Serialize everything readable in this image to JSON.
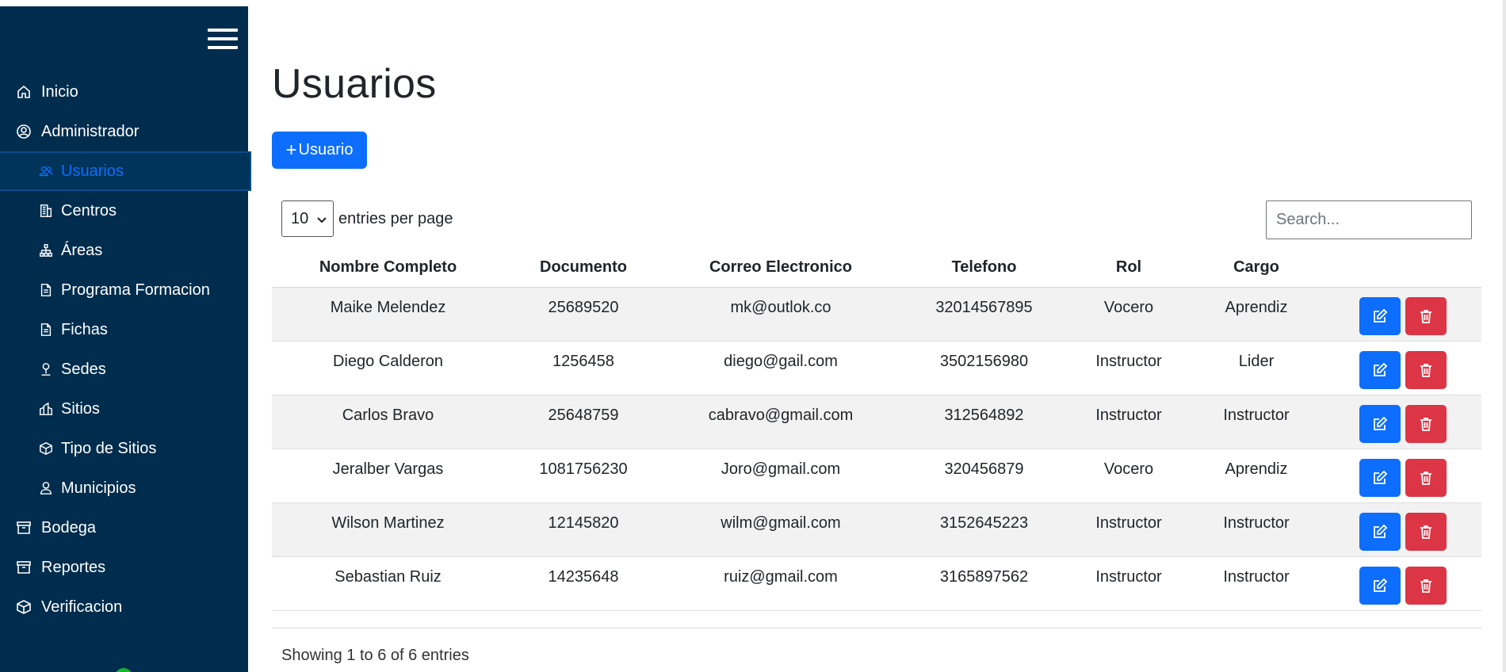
{
  "sidebar": {
    "items": [
      {
        "label": "Inicio",
        "icon": "home-icon",
        "level": 1
      },
      {
        "label": "Administrador",
        "icon": "user-circle-icon",
        "level": 1
      },
      {
        "label": "Usuarios",
        "icon": "users-icon",
        "level": 2,
        "active": true
      },
      {
        "label": "Centros",
        "icon": "building-icon",
        "level": 2
      },
      {
        "label": "Áreas",
        "icon": "hierarchy-icon",
        "level": 2
      },
      {
        "label": "Programa Formacion",
        "icon": "document-icon",
        "level": 2
      },
      {
        "label": "Fichas",
        "icon": "document-icon",
        "level": 2
      },
      {
        "label": "Sedes",
        "icon": "map-pin-icon",
        "level": 2
      },
      {
        "label": "Sitios",
        "icon": "buildings-icon",
        "level": 2
      },
      {
        "label": "Tipo de Sitios",
        "icon": "box-icon",
        "level": 2
      },
      {
        "label": "Municipios",
        "icon": "person-icon",
        "level": 2
      },
      {
        "label": "Bodega",
        "icon": "archive-icon",
        "level": 1
      },
      {
        "label": "Reportes",
        "icon": "archive-icon",
        "level": 1
      },
      {
        "label": "Verificacion",
        "icon": "box-icon",
        "level": 1
      }
    ]
  },
  "page": {
    "title": "Usuarios",
    "add_button": "Usuario"
  },
  "table_controls": {
    "per_page_value": "10",
    "per_page_label": "entries per page",
    "search_placeholder": "Search..."
  },
  "table": {
    "headers": [
      "Nombre Completo",
      "Documento",
      "Correo Electronico",
      "Telefono",
      "Rol",
      "Cargo"
    ],
    "rows": [
      {
        "nombre": "Maike Melendez",
        "documento": "25689520",
        "correo": "mk@outlok.co",
        "telefono": "32014567895",
        "rol": "Vocero",
        "cargo": "Aprendiz"
      },
      {
        "nombre": "Diego Calderon",
        "documento": "1256458",
        "correo": "diego@gail.com",
        "telefono": "3502156980",
        "rol": "Instructor",
        "cargo": "Lider"
      },
      {
        "nombre": "Carlos Bravo",
        "documento": "25648759",
        "correo": "cabravo@gmail.com",
        "telefono": "312564892",
        "rol": "Instructor",
        "cargo": "Instructor"
      },
      {
        "nombre": "Jeralber Vargas",
        "documento": "1081756230",
        "correo": "Joro@gmail.com",
        "telefono": "320456879",
        "rol": "Vocero",
        "cargo": "Aprendiz"
      },
      {
        "nombre": "Wilson Martinez",
        "documento": "12145820",
        "correo": "wilm@gmail.com",
        "telefono": "3152645223",
        "rol": "Instructor",
        "cargo": "Instructor"
      },
      {
        "nombre": "Sebastian Ruiz",
        "documento": "14235648",
        "correo": "ruiz@gmail.com",
        "telefono": "3165897562",
        "rol": "Instructor",
        "cargo": "Instructor"
      }
    ]
  },
  "footer": {
    "showing": "Showing 1 to 6 of 6 entries"
  },
  "colors": {
    "sidebar_bg": "#002d4d",
    "primary": "#0d6efd",
    "danger": "#dc3545",
    "row_stripe": "#f2f2f2"
  }
}
